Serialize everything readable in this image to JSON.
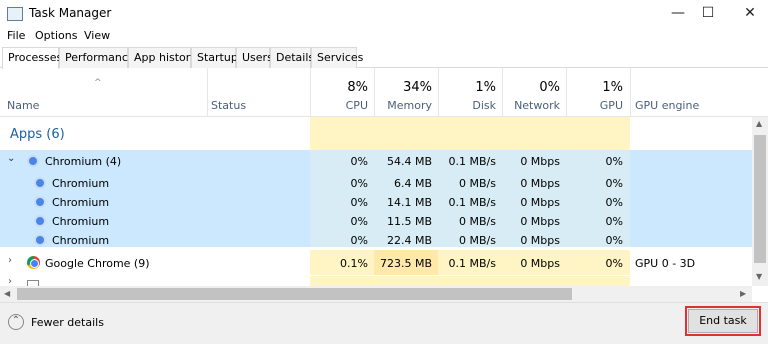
{
  "window": {
    "title": "Task Manager",
    "minimize_glyph": "—",
    "maximize_glyph": "☐",
    "close_glyph": "✕"
  },
  "menu": [
    "File",
    "Options",
    "View"
  ],
  "tabs": [
    "Processes",
    "Performance",
    "App history",
    "Startup",
    "Users",
    "Details",
    "Services"
  ],
  "columns": {
    "name": "Name",
    "status": "Status",
    "cpu": {
      "pct": "8%",
      "label": "CPU"
    },
    "memory": {
      "pct": "34%",
      "label": "Memory"
    },
    "disk": {
      "pct": "1%",
      "label": "Disk"
    },
    "network": {
      "pct": "0%",
      "label": "Network"
    },
    "gpu": {
      "pct": "1%",
      "label": "GPU"
    },
    "gpu_engine": "GPU engine"
  },
  "group": {
    "label": "Apps (6)"
  },
  "rows": [
    {
      "name": "Chromium (4)",
      "cpu": "0%",
      "memory": "54.4 MB",
      "disk": "0.1 MB/s",
      "network": "0 Mbps",
      "gpu": "0%",
      "gpu_engine": ""
    },
    {
      "name": "Chromium",
      "cpu": "0%",
      "memory": "6.4 MB",
      "disk": "0 MB/s",
      "network": "0 Mbps",
      "gpu": "0%",
      "gpu_engine": ""
    },
    {
      "name": "Chromium",
      "cpu": "0%",
      "memory": "14.1 MB",
      "disk": "0.1 MB/s",
      "network": "0 Mbps",
      "gpu": "0%",
      "gpu_engine": ""
    },
    {
      "name": "Chromium",
      "cpu": "0%",
      "memory": "11.5 MB",
      "disk": "0 MB/s",
      "network": "0 Mbps",
      "gpu": "0%",
      "gpu_engine": ""
    },
    {
      "name": "Chromium",
      "cpu": "0%",
      "memory": "22.4 MB",
      "disk": "0 MB/s",
      "network": "0 Mbps",
      "gpu": "0%",
      "gpu_engine": ""
    },
    {
      "name": "Google Chrome (9)",
      "cpu": "0.1%",
      "memory": "723.5 MB",
      "disk": "0.1 MB/s",
      "network": "0 Mbps",
      "gpu": "0%",
      "gpu_engine": "GPU 0 - 3D"
    }
  ],
  "footer": {
    "fewer_details": "Fewer details",
    "end_task": "End task"
  },
  "colors": {
    "selected_row": "#cce8ff",
    "heat_light": "#fff4c4",
    "heat_medium": "#ffe9a8",
    "group_text": "#1c5fa8",
    "highlight_border": "#e03030"
  }
}
